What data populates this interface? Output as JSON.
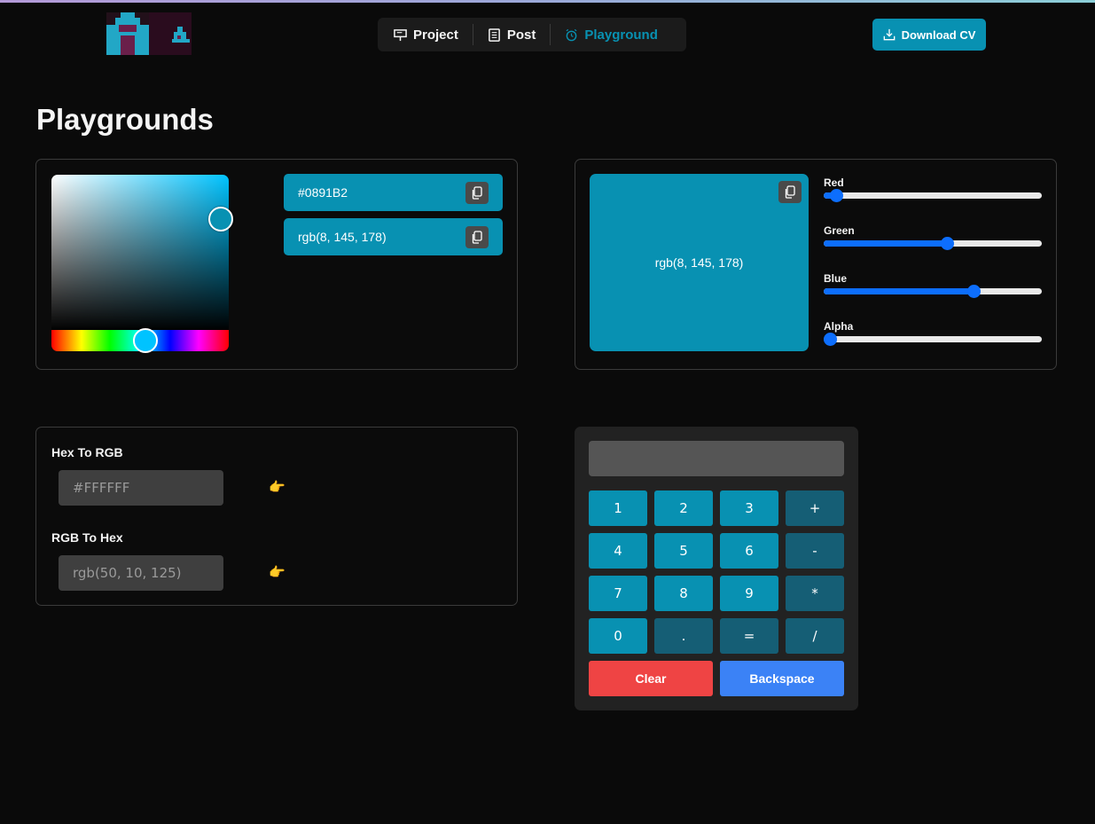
{
  "header": {
    "nav": [
      {
        "label": "Project",
        "icon": "presentation-icon"
      },
      {
        "label": "Post",
        "icon": "document-icon"
      },
      {
        "label": "Playground",
        "icon": "alarm-clock-icon"
      }
    ],
    "active_nav": "Playground",
    "download_cv_label": "Download CV"
  },
  "page": {
    "title": "Playgrounds"
  },
  "picker": {
    "hex_value": "#0891B2",
    "rgb_value": "rgb(8, 145, 178)",
    "color": "#0891b2"
  },
  "sliders": {
    "preview_text": "rgb(8, 145, 178)",
    "items": [
      {
        "label": "Red",
        "value": 8,
        "max": 255
      },
      {
        "label": "Green",
        "value": 145,
        "max": 255
      },
      {
        "label": "Blue",
        "value": 178,
        "max": 255
      },
      {
        "label": "Alpha",
        "value": 0,
        "max": 1
      }
    ]
  },
  "converter": {
    "hex_to_rgb_label": "Hex To RGB",
    "hex_placeholder": "#FFFFFF",
    "rgb_to_hex_label": "RGB To Hex",
    "rgb_placeholder": "rgb(50, 10, 125)"
  },
  "calculator": {
    "display": "",
    "keys": [
      [
        "1",
        "2",
        "3",
        "+"
      ],
      [
        "4",
        "5",
        "6",
        "-"
      ],
      [
        "7",
        "8",
        "9",
        "*"
      ],
      [
        "0",
        ".",
        "=",
        "/"
      ]
    ],
    "clear_label": "Clear",
    "backspace_label": "Backspace"
  },
  "colors": {
    "accent": "#0891b2",
    "slider": "#0d6efd",
    "clear": "#ef4444",
    "backspace": "#3b82f6"
  }
}
